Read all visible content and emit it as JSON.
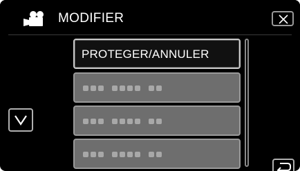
{
  "header": {
    "title": "MODIFIER",
    "mode_icon": "video-camera-icon",
    "close_icon": "close-icon"
  },
  "menu": {
    "items": [
      {
        "label": "PROTEGER/ANNULER",
        "style": "highlighted"
      },
      {
        "label": "",
        "style": "blank"
      },
      {
        "label": "",
        "style": "blank"
      },
      {
        "label": "",
        "style": "blank"
      }
    ]
  },
  "controls": {
    "scroll_down_icon": "chevron-down-icon",
    "back_icon": "return-arrow-icon"
  },
  "colors": {
    "background": "#000000",
    "item_blank": "#6e6e6e",
    "border": "#b0b0b0",
    "text": "#ffffff"
  }
}
